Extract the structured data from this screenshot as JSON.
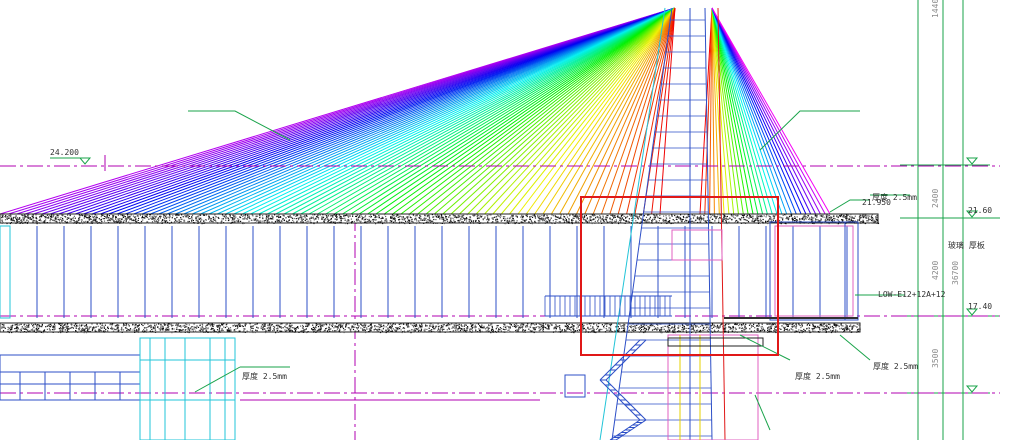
{
  "colors": {
    "background": "#ffffff",
    "guide_magenta": "#b000b0",
    "leader_green": "#19a34a",
    "frame_blue": "#2d4fc7",
    "cyan": "#22c4d8",
    "highlight_red": "#e01818"
  },
  "drawing": {
    "elevations": {
      "left_main": "24.200",
      "right_upper": "21.60",
      "right_mid": "17.40",
      "beam_top": "21.950"
    },
    "dimensions": {
      "top": "1440",
      "d2400": "2400",
      "d4200": "4200",
      "d3500": "3500",
      "d36700": "36700"
    },
    "callouts": {
      "thickness_1": "厚度 2.5mm",
      "thickness_2": "厚度 2.5mm",
      "thickness_3": "厚度 2.5mm",
      "thickness_4": "厚度 2.5mm",
      "glass_spec": "LOW-E12+12A+12"
    },
    "side_note": "玻璃  厚板"
  }
}
